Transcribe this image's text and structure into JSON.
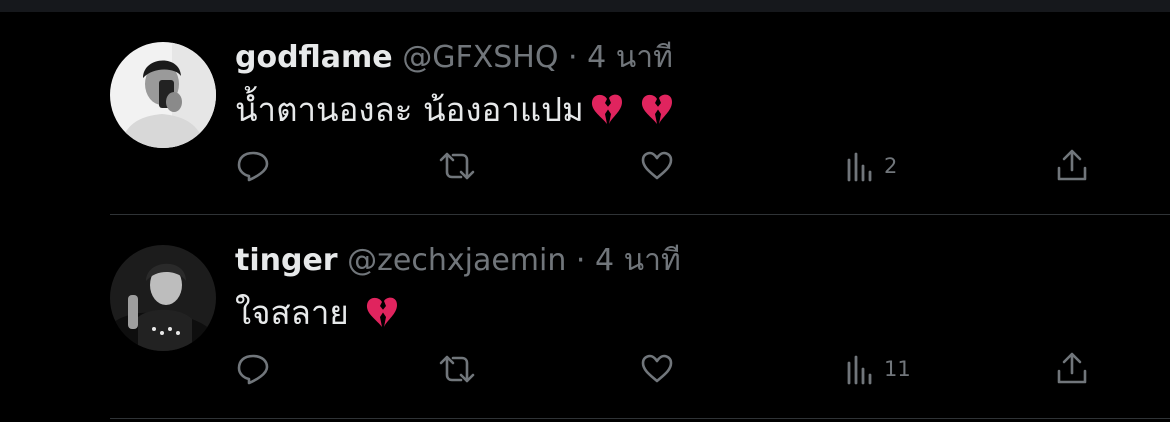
{
  "tweets": [
    {
      "display_name": "godflame",
      "handle": "@GFXSHQ",
      "separator": "·",
      "time": "4 นาที",
      "text": "น้ำตานองละ น้องอาแปม",
      "emoji": [
        "broken-heart",
        "broken-heart"
      ],
      "actions": {
        "reply": "",
        "retweet": "",
        "like": "",
        "views": "2",
        "share": ""
      }
    },
    {
      "display_name": "tinger",
      "handle": "@zechxjaemin",
      "separator": "·",
      "time": "4 นาที",
      "text": "ใจสลาย",
      "emoji": [
        "broken-heart"
      ],
      "actions": {
        "reply": "",
        "retweet": "",
        "like": "",
        "views": "11",
        "share": ""
      }
    }
  ],
  "colors": {
    "background": "#000000",
    "text_primary": "#e7e9ea",
    "text_secondary": "#71767b",
    "divider": "#2f3336",
    "broken_heart": "#e0245e"
  }
}
